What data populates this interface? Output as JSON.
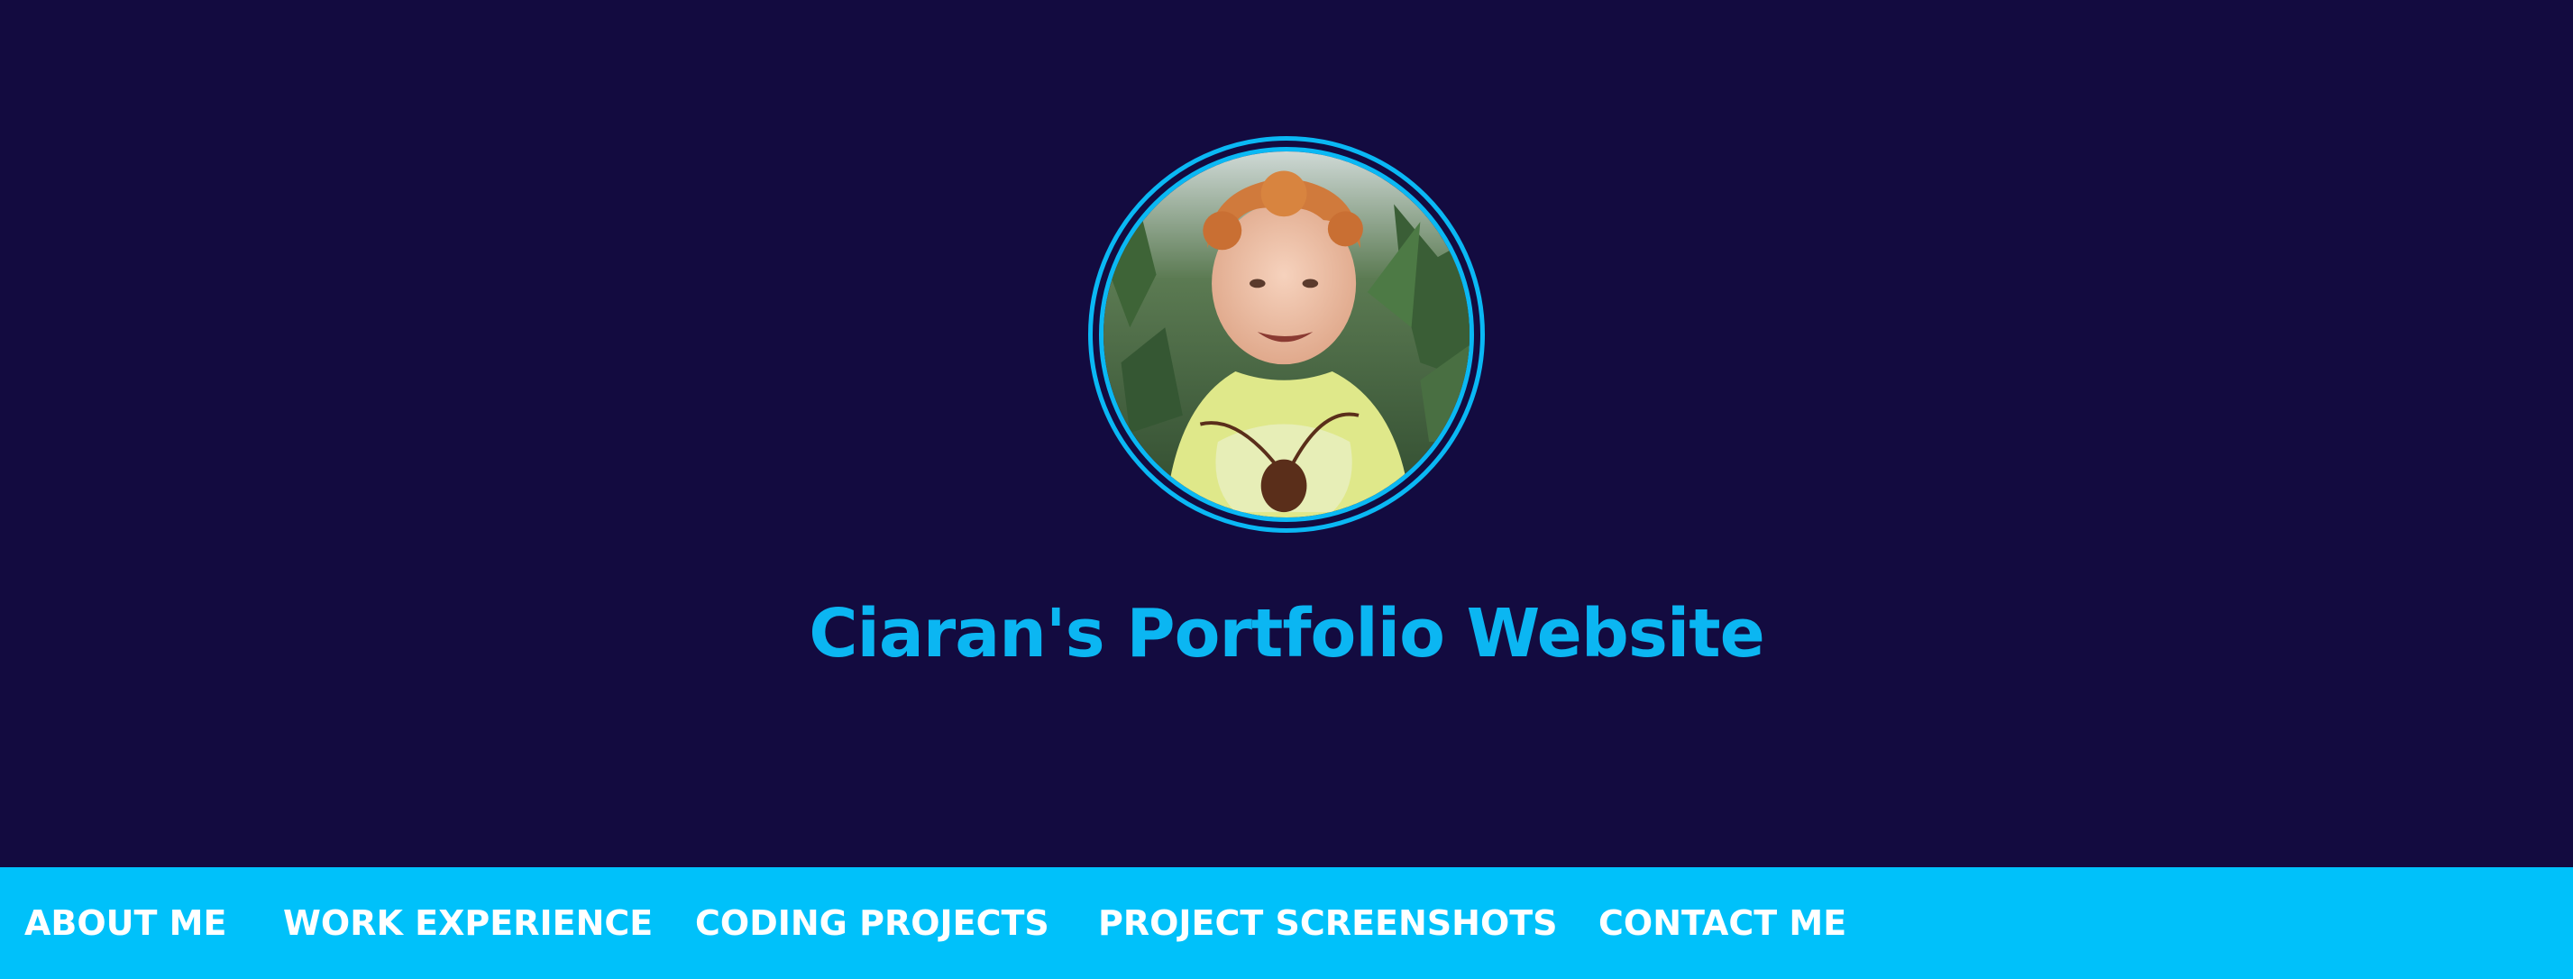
{
  "header": {
    "title": "Ciaran's Portfolio Website",
    "avatar_icon": "profile-photo"
  },
  "nav": {
    "items": [
      {
        "label": "ABOUT ME"
      },
      {
        "label": "WORK EXPERIENCE"
      },
      {
        "label": "CODING PROJECTS"
      },
      {
        "label": "PROJECT SCREENSHOTS"
      },
      {
        "label": "CONTACT ME"
      }
    ]
  },
  "colors": {
    "background": "#130b40",
    "accent": "#0bb6f2",
    "nav_background": "#00c1fa",
    "nav_text": "#ffffff"
  }
}
